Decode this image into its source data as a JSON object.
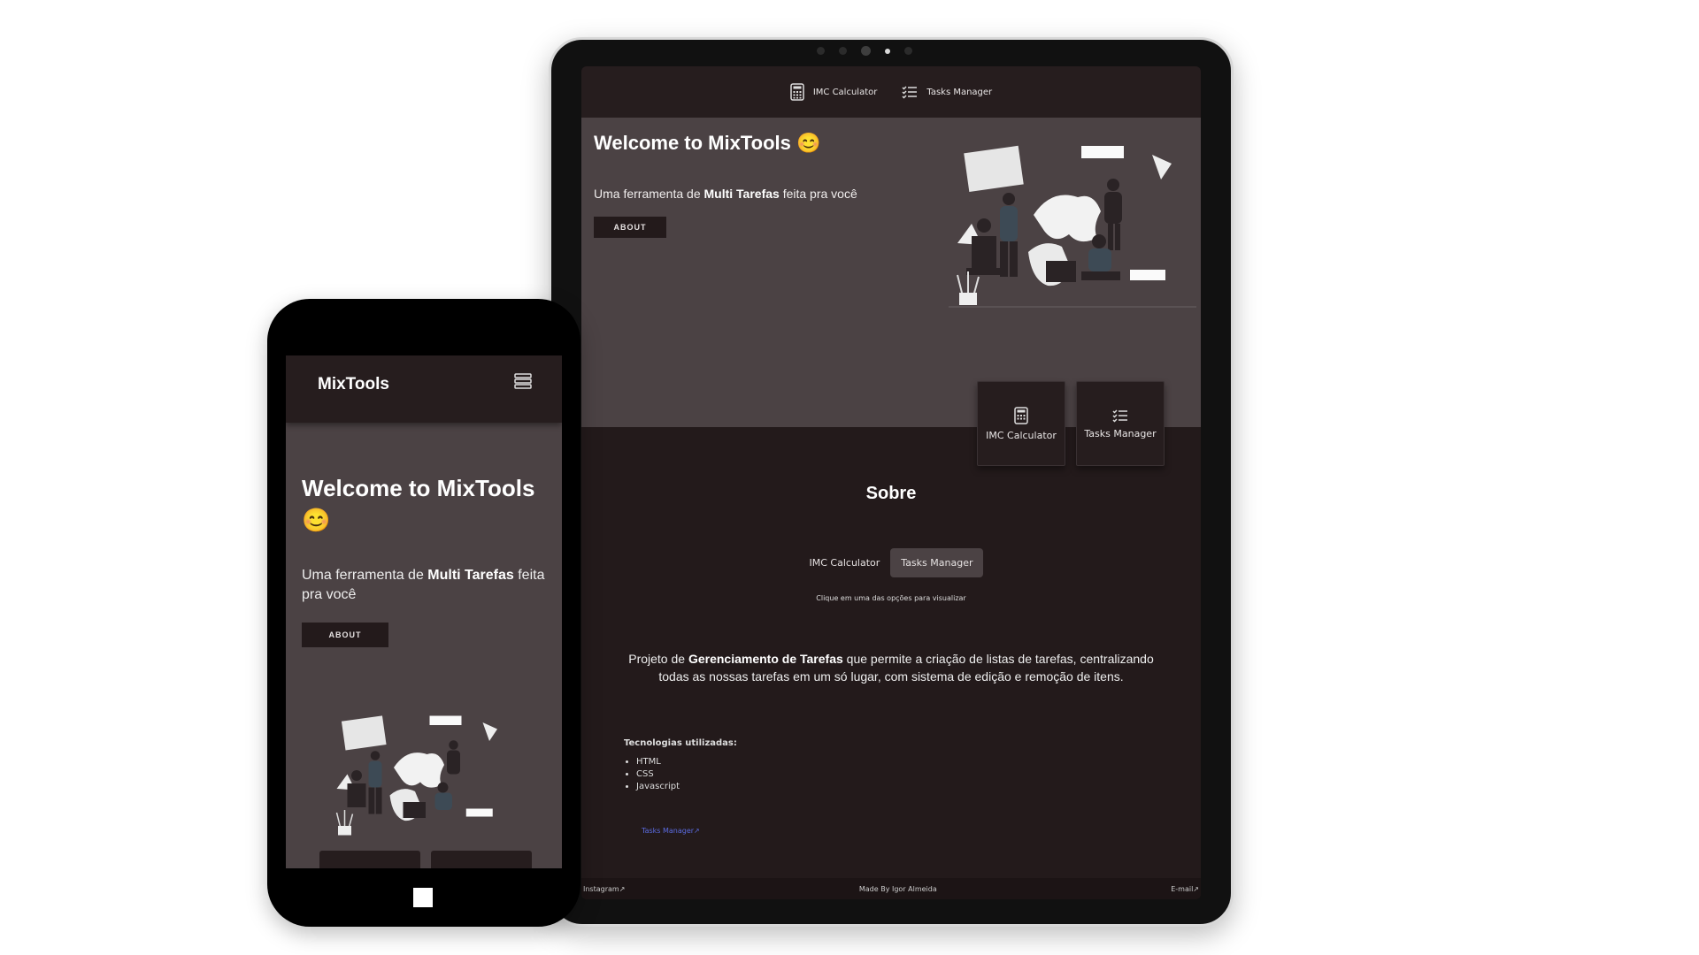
{
  "tablet": {
    "nav": {
      "items": [
        {
          "label": "IMC Calculator",
          "icon": "calculator-icon"
        },
        {
          "label": "Tasks Manager",
          "icon": "tasks-list-icon"
        }
      ]
    },
    "hero": {
      "title": "Welcome to MixTools",
      "emoji": "😊",
      "subtitle_prefix": "Uma ferramenta de ",
      "subtitle_bold": "Multi Tarefas",
      "subtitle_suffix": " feita pra você",
      "about_label": "ABOUT"
    },
    "cards": [
      {
        "label": "IMC Calculator",
        "icon": "calculator-icon"
      },
      {
        "label": "Tasks Manager",
        "icon": "tasks-list-icon"
      }
    ],
    "sobre": {
      "title": "Sobre",
      "tabs": [
        {
          "label": "IMC Calculator",
          "active": false
        },
        {
          "label": "Tasks Manager",
          "active": true
        }
      ],
      "hint": "Clique em uma das opções para visualizar",
      "desc_prefix": "Projeto de ",
      "desc_bold": "Gerenciamento de Tarefas",
      "desc_suffix": " que permite a criação de listas de tarefas, centralizando todas as nossas tarefas em um só lugar, com sistema de edição e remoção de itens.",
      "tech_heading": "Tecnologias utilizadas:",
      "tech": [
        "HTML",
        "CSS",
        "Javascript"
      ],
      "link_label": "Tasks Manager↗"
    },
    "footer": {
      "left": "Instagram↗",
      "center": "Made By Igor Almeida",
      "right": "E-mail↗"
    }
  },
  "phone": {
    "brand": "MixTools",
    "menu_icon": "hamburger-menu-icon",
    "hero": {
      "title": "Welcome to MixTools",
      "emoji": "😊",
      "subtitle_prefix": "Uma ferramenta de ",
      "subtitle_bold": "Multi Tarefas",
      "subtitle_suffix": " feita pra você",
      "about_label": "ABOUT"
    }
  },
  "colors": {
    "dark": "#231a1b",
    "nav": "#261d1e",
    "hero": "#4b4244",
    "link": "#5a6be0",
    "text": "#ffffff"
  }
}
